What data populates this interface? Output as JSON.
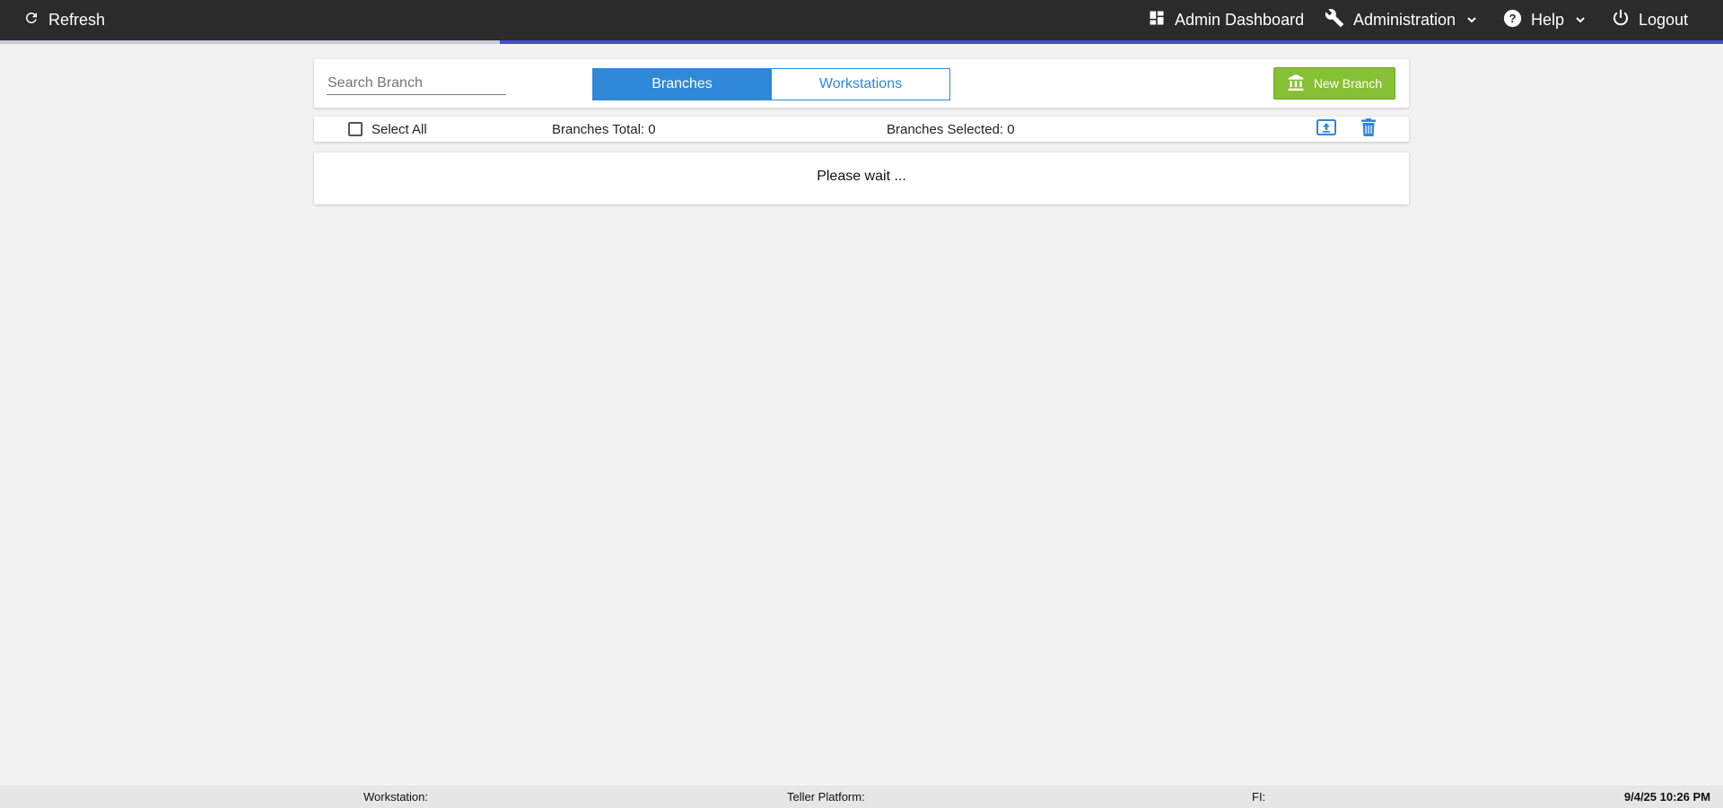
{
  "header": {
    "refresh_label": "Refresh",
    "admin_dashboard_label": "Admin Dashboard",
    "administration_label": "Administration",
    "help_label": "Help",
    "logout_label": "Logout",
    "loading_progress": 0.71
  },
  "toolbar": {
    "search_placeholder": "Search Branch",
    "search_value": "",
    "tabs": [
      {
        "label": "Branches",
        "active": true
      },
      {
        "label": "Workstations",
        "active": false
      }
    ],
    "new_branch_label": "New Branch"
  },
  "list_header": {
    "select_all_label": "Select All",
    "select_all_checked": false,
    "branches_total": "Branches Total: 0",
    "branches_selected": "Branches Selected: 0"
  },
  "content": {
    "status_text": "Please wait ..."
  },
  "footer": {
    "workstation": "Workstation:",
    "teller_platform": "Teller Platform:",
    "fi": "FI:",
    "datetime": "9/4/25 10:26 PM"
  },
  "colors": {
    "topbar": "#2b2b2b",
    "accent_blue": "#2f88d8",
    "new_branch_green": "#86c034",
    "progress": "#3f4fd0"
  },
  "icons": {
    "refresh": "refresh-icon",
    "admin_dashboard": "dashboard-icon",
    "administration": "wrench-icon",
    "help": "help-icon",
    "logout": "power-icon",
    "new_branch": "bank-icon",
    "upload": "upload-icon",
    "delete": "trash-icon"
  }
}
